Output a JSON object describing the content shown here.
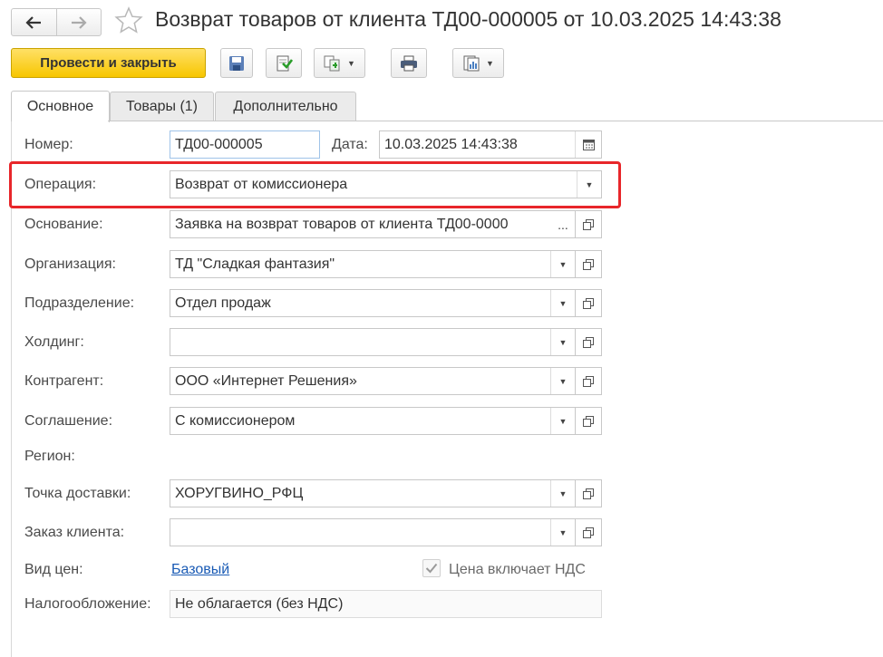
{
  "window": {
    "title": "Возврат товаров от клиента ТД00-000005 от 10.03.2025 14:43:38"
  },
  "toolbar": {
    "post_and_close_label": "Провести и закрыть"
  },
  "tabs": [
    {
      "label": "Основное",
      "active": true
    },
    {
      "label": "Товары (1)",
      "active": false
    },
    {
      "label": "Дополнительно",
      "active": false
    }
  ],
  "form": {
    "number_label": "Номер:",
    "number_value": "ТД00-000005",
    "date_label": "Дата:",
    "date_value": "10.03.2025 14:43:38",
    "operation_label": "Операция:",
    "operation_value": "Возврат от комиссионера",
    "basis_label": "Основание:",
    "basis_value": "Заявка на возврат товаров от клиента ТД00-0000",
    "basis_ellipsis": "...",
    "organization_label": "Организация:",
    "organization_value": "ТД \"Сладкая фантазия\"",
    "department_label": "Подразделение:",
    "department_value": "Отдел продаж",
    "holding_label": "Холдинг:",
    "holding_value": "",
    "counterparty_label": "Контрагент:",
    "counterparty_value": "ООО «Интернет Решения»",
    "agreement_label": "Соглашение:",
    "agreement_value": "С комиссионером",
    "region_label": "Регион:",
    "delivery_point_label": "Точка доставки:",
    "delivery_point_value": "ХОРУГВИНО_РФЦ",
    "client_order_label": "Заказ клиента:",
    "client_order_value": "",
    "price_type_label": "Вид цен:",
    "price_type_value": "Базовый",
    "price_includes_vat_label": "Цена включает НДС",
    "price_includes_vat_checked": true,
    "taxation_label": "Налогообложение:",
    "taxation_value": "Не облагается (без НДС)"
  },
  "colors": {
    "accent_button": "#f7c600",
    "highlight_frame": "#e8262a",
    "link": "#1a5bb5"
  }
}
